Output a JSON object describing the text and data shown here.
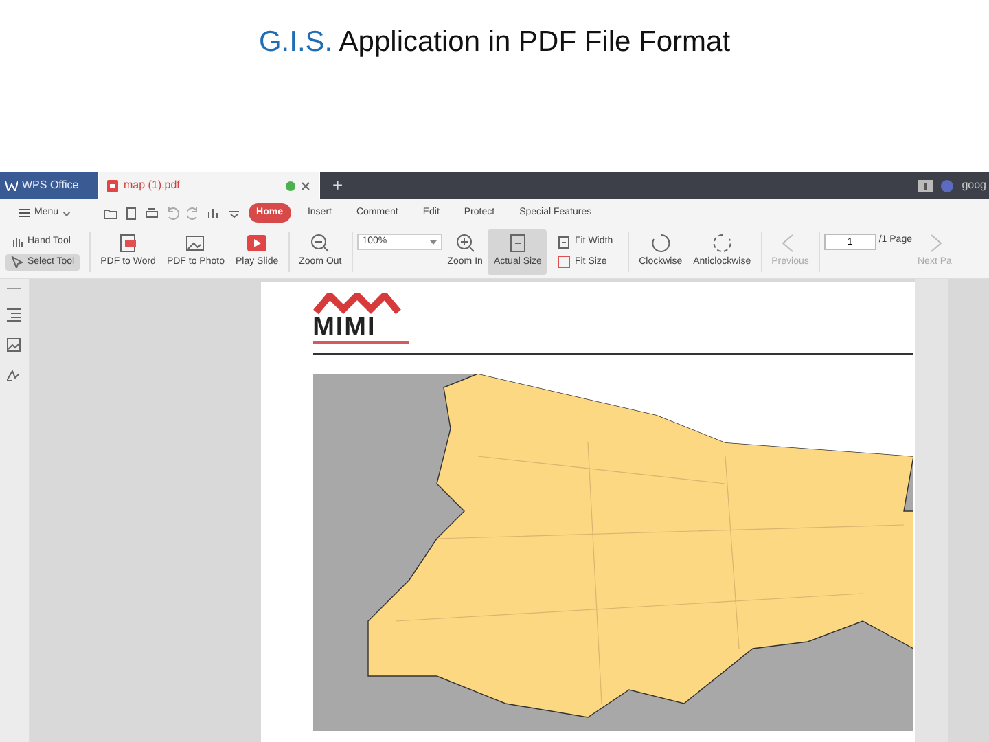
{
  "slide": {
    "title_prefix": "G.I.S.",
    "title_rest": "Application in PDF File Format"
  },
  "tabs": [
    {
      "label": "WPS Office",
      "kind": "app",
      "selected": false
    },
    {
      "label": "map (1).pdf",
      "kind": "doc",
      "selected": true
    }
  ],
  "new_tab": "+",
  "account": {
    "label": "goog"
  },
  "menu": {
    "label": "Menu"
  },
  "ribbon_tabs": [
    {
      "label": "Home",
      "selected": true
    },
    {
      "label": "Insert",
      "selected": false
    },
    {
      "label": "Comment",
      "selected": false
    },
    {
      "label": "Edit",
      "selected": false
    },
    {
      "label": "Protect",
      "selected": false
    },
    {
      "label": "Special Features",
      "selected": false
    }
  ],
  "toolbar": [
    {
      "kind": "pair",
      "items": [
        {
          "label": "Hand Tool",
          "selected": false
        },
        {
          "label": "Select Tool",
          "selected": true
        }
      ]
    },
    {
      "kind": "big",
      "label": "PDF to Word",
      "selected": false,
      "disabled": false
    },
    {
      "kind": "big",
      "label": "PDF to Photo",
      "selected": false,
      "disabled": false
    },
    {
      "kind": "big",
      "label": "Play Slide",
      "selected": false,
      "disabled": false
    },
    {
      "kind": "big",
      "label": "Zoom Out",
      "selected": false,
      "disabled": false
    },
    {
      "kind": "field",
      "value": "100%"
    },
    {
      "kind": "big",
      "label": "Zoom In",
      "selected": false,
      "disabled": false
    },
    {
      "kind": "big",
      "label": "Actual Size",
      "selected": true,
      "disabled": false
    },
    {
      "kind": "pair",
      "items": [
        {
          "label": "Fit Width",
          "selected": false
        },
        {
          "label": "Fit Size",
          "selected": false
        }
      ]
    },
    {
      "kind": "big",
      "label": "Clockwise",
      "selected": false,
      "disabled": false
    },
    {
      "kind": "big",
      "label": "Anticlockwise",
      "selected": false,
      "disabled": false
    },
    {
      "kind": "big",
      "label": "Previous",
      "selected": false,
      "disabled": true
    },
    {
      "kind": "page",
      "value": "1",
      "suffix": "/1 Page"
    },
    {
      "kind": "big",
      "label": "Next Pa",
      "selected": false,
      "disabled": true
    }
  ],
  "document": {
    "logo_text": "MIMI"
  }
}
